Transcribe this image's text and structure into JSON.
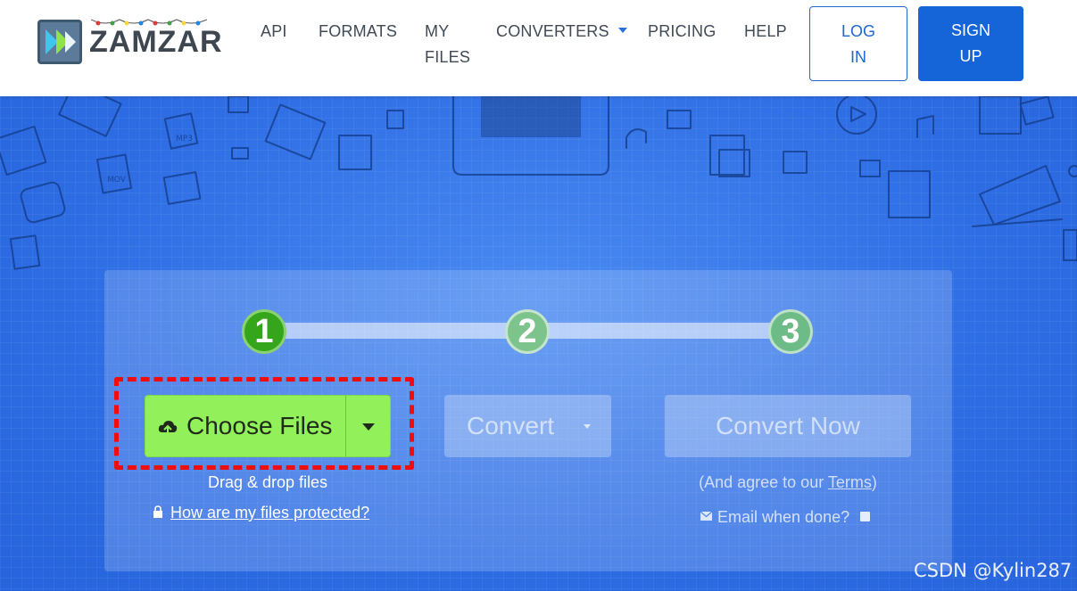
{
  "header": {
    "logo_text": "ZAMZAR",
    "logo_tm": "™",
    "nav": {
      "api": "API",
      "formats": "FORMATS",
      "my_files_line1": "MY",
      "my_files_line2": "FILES",
      "converters": "CONVERTERS",
      "pricing": "PRICING",
      "help": "HELP"
    },
    "login_line1": "LOG",
    "login_line2": "IN",
    "signup_line1": "SIGN",
    "signup_line2": "UP"
  },
  "steps": [
    "1",
    "2",
    "3"
  ],
  "choose_files": {
    "label": "Choose Files",
    "icon": "upload-cloud-icon",
    "dropdown_icon": "caret-down-icon"
  },
  "drag_drop": "Drag & drop files",
  "protected_link": "How are my files protected?",
  "convert": {
    "label": "Convert",
    "icon": "caret-down-icon"
  },
  "convert_now": {
    "label": "Convert Now"
  },
  "agree": {
    "prefix": "(And agree to our ",
    "terms": "Terms",
    "suffix": ")"
  },
  "email_when_done": "Email when done?",
  "watermark": "CSDN @Kylin287",
  "colors": {
    "brand_blue": "#1565d8",
    "hero_blue": "#2f6fe6",
    "choose_green": "#92f15a",
    "step_active": "#35a61b",
    "highlight_red": "#f20d0d"
  }
}
